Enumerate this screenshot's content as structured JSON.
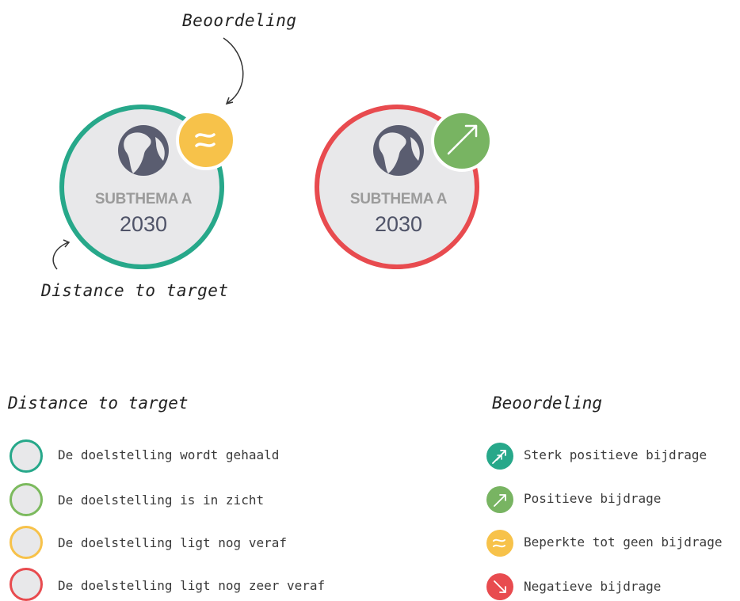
{
  "annotations": {
    "beoordeling": "Beoordeling",
    "distance_to_target": "Distance to target"
  },
  "examples": [
    {
      "label": "SUBTHEMA A",
      "year": "2030",
      "ring_color": "#27a88a",
      "badge_color": "#f7c24a",
      "badge_icon": "approx-equal-icon"
    },
    {
      "label": "SUBTHEMA A",
      "year": "2030",
      "ring_color": "#e84b4f",
      "badge_color": "#78b462",
      "badge_icon": "arrow-up-right-icon"
    }
  ],
  "legend_distance": {
    "title": "Distance to target",
    "items": [
      {
        "label": "De doelstelling wordt gehaald",
        "color": "#27a88a"
      },
      {
        "label": "De doelstelling is in zicht",
        "color": "#7cba5e"
      },
      {
        "label": "De doelstelling ligt nog veraf",
        "color": "#f7c24a"
      },
      {
        "label": "De doelstelling ligt nog zeer veraf",
        "color": "#e84b4f"
      }
    ]
  },
  "legend_beoordeling": {
    "title": "Beoordeling",
    "items": [
      {
        "label": "Sterk positieve bijdrage",
        "color": "#27a88a",
        "icon": "double-arrow-up-right-icon"
      },
      {
        "label": "Positieve bijdrage",
        "color": "#78b462",
        "icon": "arrow-up-right-icon"
      },
      {
        "label": "Beperkte tot geen bijdrage",
        "color": "#f7c24a",
        "icon": "approx-equal-icon"
      },
      {
        "label": "Negatieve bijdrage",
        "color": "#e84b4f",
        "icon": "arrow-down-right-icon"
      }
    ]
  }
}
